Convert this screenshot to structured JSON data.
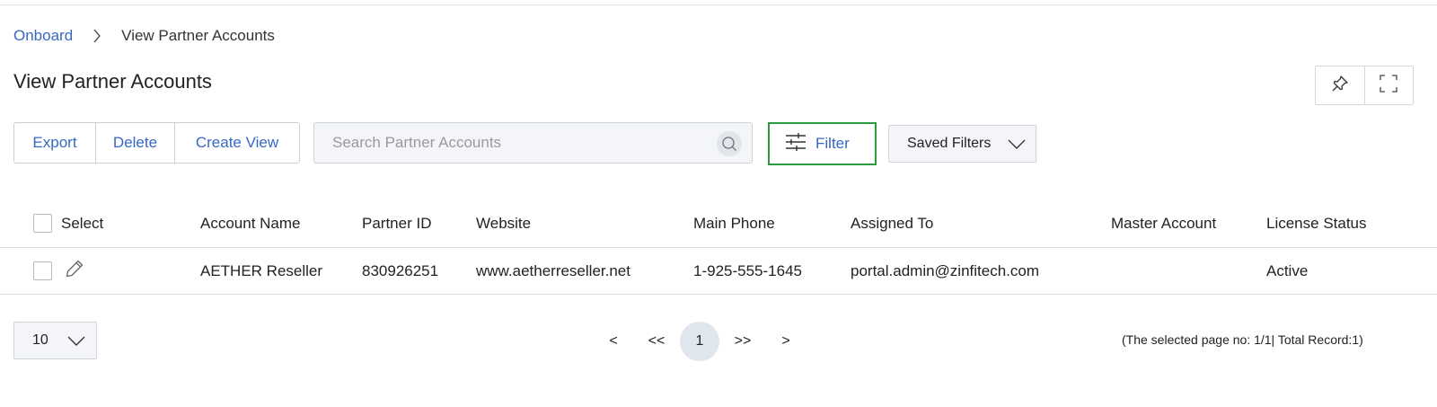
{
  "breadcrumb": {
    "root": "Onboard",
    "current": "View Partner Accounts"
  },
  "page": {
    "title": "View Partner Accounts"
  },
  "toolbar": {
    "export_label": "Export",
    "delete_label": "Delete",
    "create_view_label": "Create View",
    "search_placeholder": "Search Partner Accounts",
    "filter_label": "Filter",
    "saved_filters_label": "Saved Filters"
  },
  "table": {
    "columns": [
      "Select",
      "Account Name",
      "Partner ID",
      "Website",
      "Main Phone",
      "Assigned To",
      "Master Account",
      "License Status"
    ],
    "rows": [
      {
        "account_name": "AETHER Reseller",
        "partner_id": "830926251",
        "website": "www.aetherreseller.net",
        "main_phone": "1-925-555-1645",
        "assigned_to": "portal.admin@zinfitech.com",
        "master_account": "",
        "license_status": "Active"
      }
    ]
  },
  "pagination": {
    "page_size": "10",
    "prev": "<",
    "first": "<<",
    "current_page": "1",
    "last": ">>",
    "next": ">",
    "record_info": "(The selected page no: 1/1| Total Record:1)"
  },
  "colors": {
    "accent": "#3767c4",
    "filter_border": "#2e9b3f",
    "field_bg": "#f3f5f8"
  }
}
